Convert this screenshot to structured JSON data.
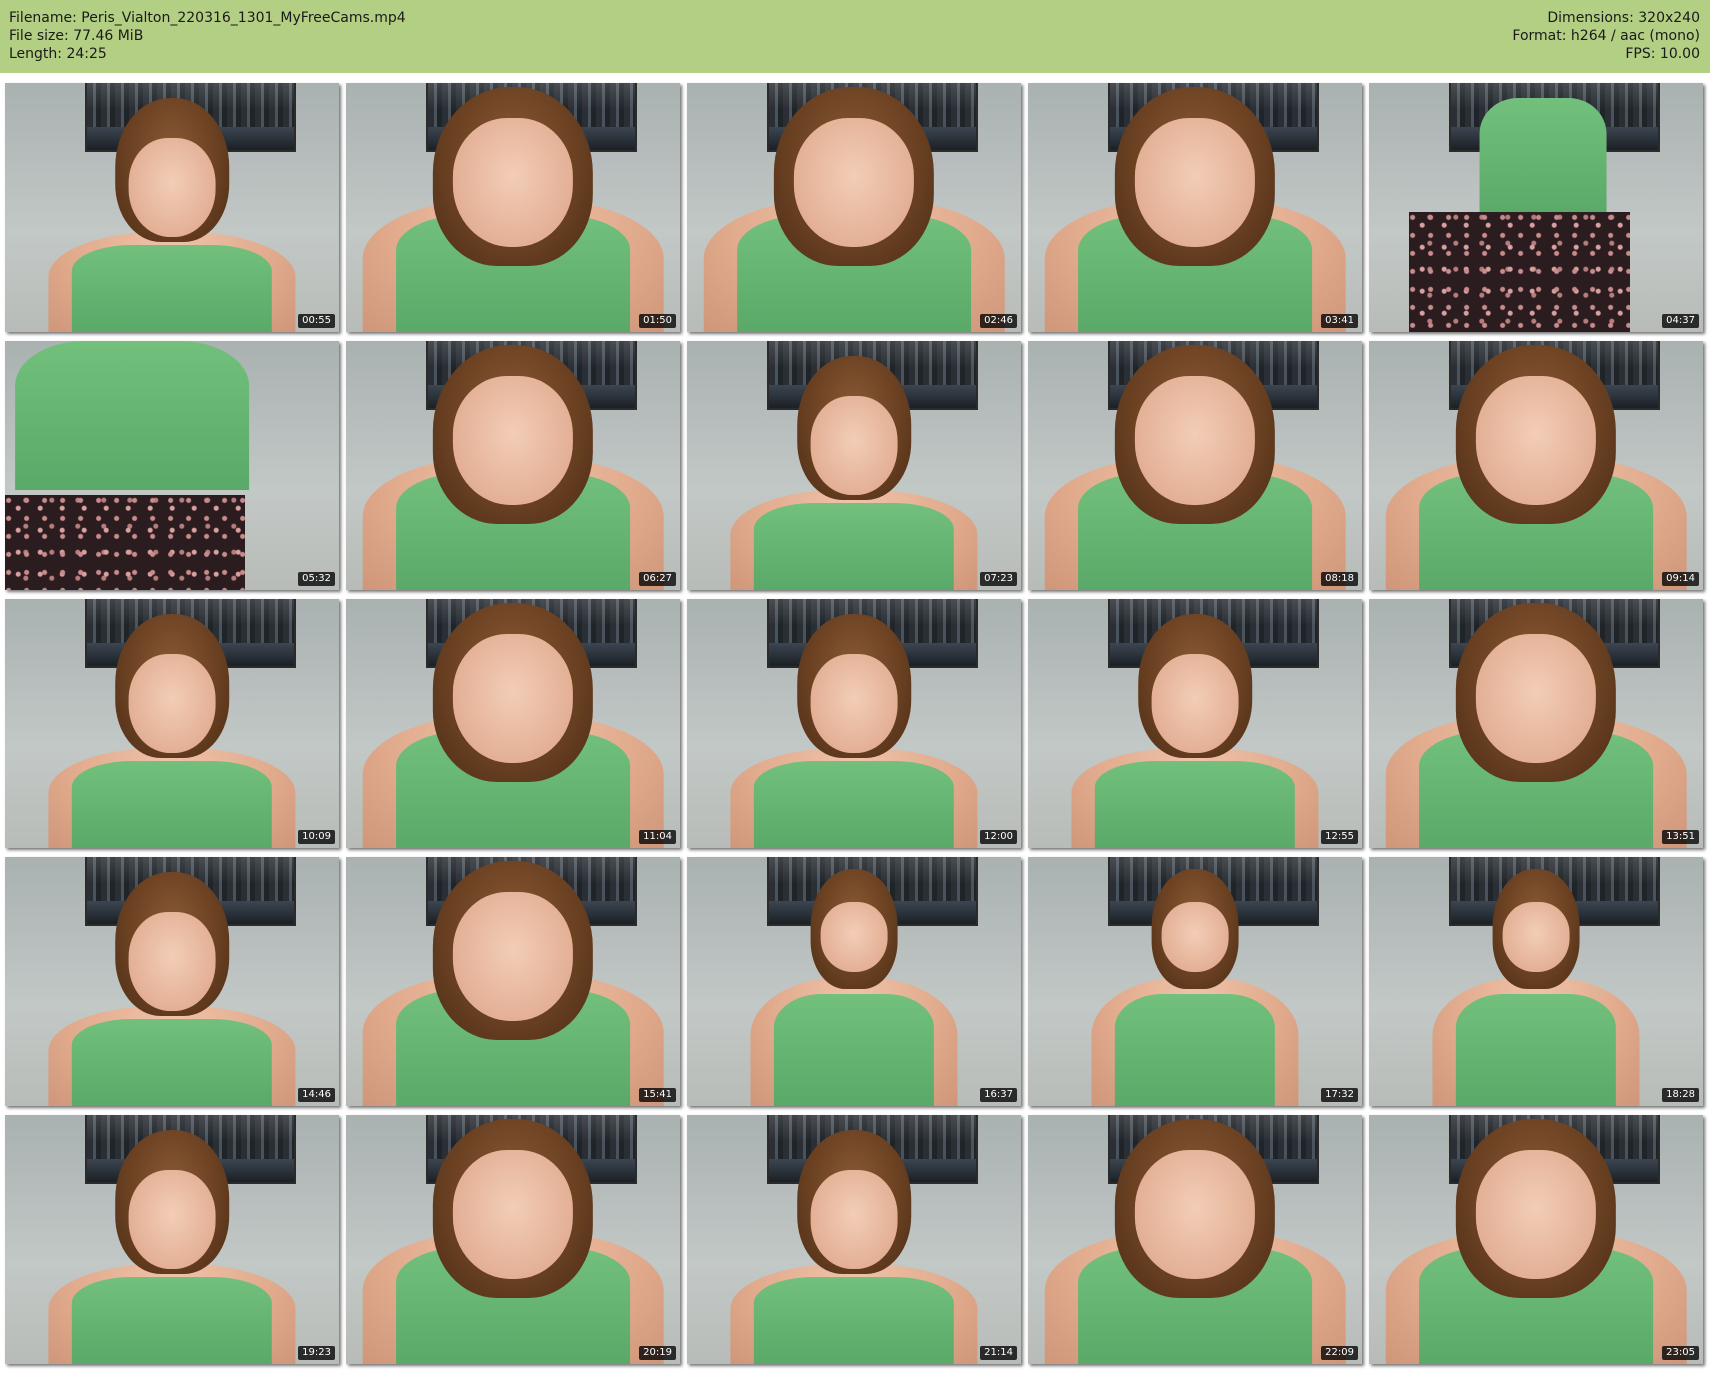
{
  "header": {
    "filename_label": "Filename: Peris_Vialton_220316_1301_MyFreeCams.mp4",
    "filesize_label": "File size: 77.46 MiB",
    "length_label": "Length: 24:25",
    "dimensions_label": "Dimensions: 320x240",
    "format_label": "Format: h264 / aac (mono)",
    "fps_label": "FPS: 10.00"
  },
  "colors": {
    "header_background": "#b3cf83",
    "tank_top": "#6cba78",
    "hair": "#6b4122"
  },
  "thumbnails": [
    {
      "time": "00:55",
      "pose": "full"
    },
    {
      "time": "01:50",
      "pose": "close"
    },
    {
      "time": "02:46",
      "pose": "close"
    },
    {
      "time": "03:41",
      "pose": "close"
    },
    {
      "time": "04:37",
      "pose": "standing"
    },
    {
      "time": "05:32",
      "pose": "standing-close"
    },
    {
      "time": "06:27",
      "pose": "close"
    },
    {
      "time": "07:23",
      "pose": "full"
    },
    {
      "time": "08:18",
      "pose": "close"
    },
    {
      "time": "09:14",
      "pose": "close"
    },
    {
      "time": "10:09",
      "pose": "full"
    },
    {
      "time": "11:04",
      "pose": "close"
    },
    {
      "time": "12:00",
      "pose": "full"
    },
    {
      "time": "12:55",
      "pose": "full"
    },
    {
      "time": "13:51",
      "pose": "close"
    },
    {
      "time": "14:46",
      "pose": "full"
    },
    {
      "time": "15:41",
      "pose": "close"
    },
    {
      "time": "16:37",
      "pose": "far"
    },
    {
      "time": "17:32",
      "pose": "far"
    },
    {
      "time": "18:28",
      "pose": "far"
    },
    {
      "time": "19:23",
      "pose": "full"
    },
    {
      "time": "20:19",
      "pose": "close"
    },
    {
      "time": "21:14",
      "pose": "full"
    },
    {
      "time": "22:09",
      "pose": "close"
    },
    {
      "time": "23:05",
      "pose": "close"
    }
  ]
}
